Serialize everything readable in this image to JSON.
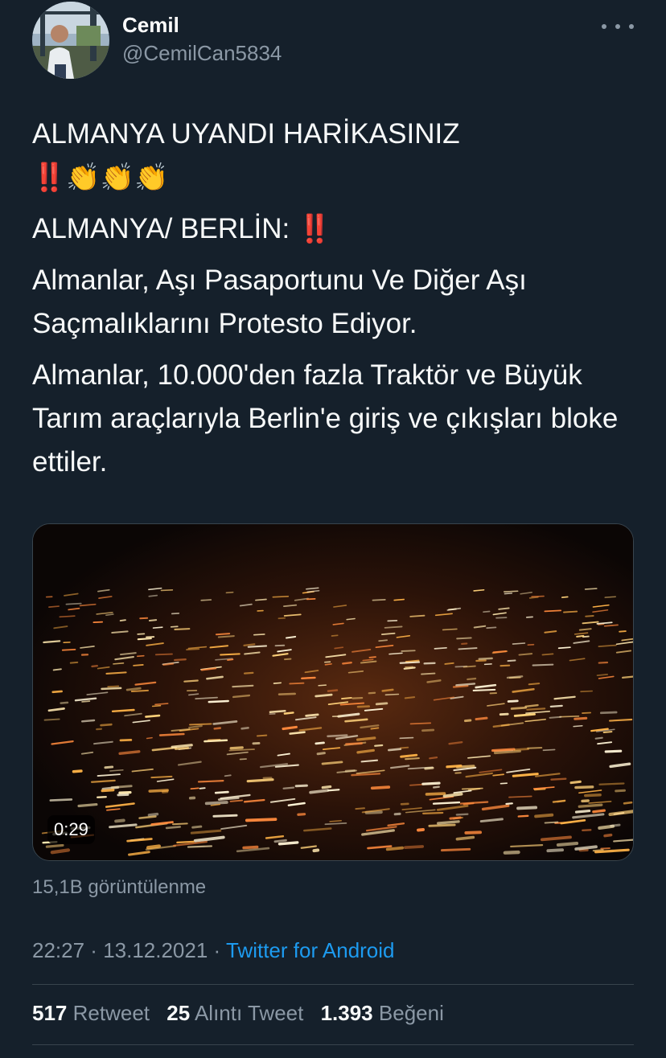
{
  "user": {
    "display_name": "Cemil",
    "handle": "@CemilCan5834"
  },
  "tweet": {
    "line1": "ALMANYA UYANDI HARİKASINIZ",
    "line1_emoji": "‼️👏👏👏",
    "line2": "ALMANYA/ BERLİN: ",
    "line2_emoji": "‼️",
    "paragraph1": "Almanlar, Aşı Pasaportunu Ve Diğer Aşı Saçmalıklarını Protesto Ediyor.",
    "paragraph2": "Almanlar, 10.000'den fazla Traktör ve Büyük Tarım araçlarıyla Berlin'e giriş ve çıkışları bloke ettiler."
  },
  "video": {
    "duration": "0:29"
  },
  "views": "15,1B görüntülenme",
  "meta": {
    "time": "22:27",
    "separator": " · ",
    "date": "13.12.2021",
    "source": "Twitter for Android"
  },
  "stats": {
    "retweets_count": "517",
    "retweets_label": "Retweet",
    "quotes_count": "25",
    "quotes_label": "Alıntı Tweet",
    "likes_count": "1.393",
    "likes_label": "Beğeni"
  },
  "colors": {
    "background": "#15202b",
    "text": "#f7f9f9",
    "secondary": "#8b98a5",
    "link": "#1d9bf0",
    "divider": "#38444d",
    "bang": "#e0243c"
  },
  "icons": {
    "more": "more-horizontal-icon",
    "clap": "clapping-hands-icon",
    "bang": "double-exclamation-icon"
  }
}
